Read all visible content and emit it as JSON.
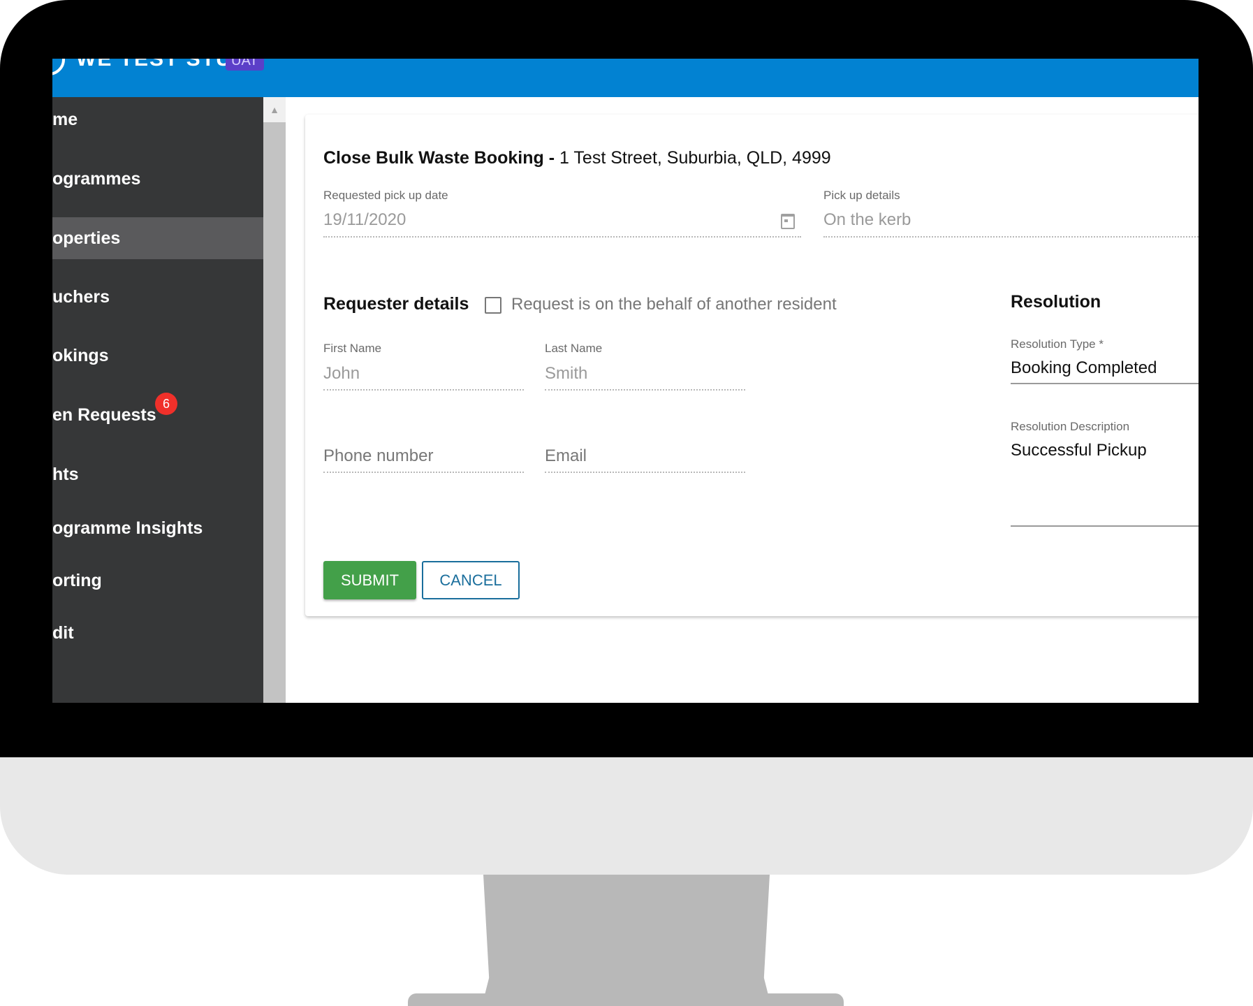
{
  "app": {
    "title": "WE TEST STUFF",
    "env_badge": "UAT"
  },
  "sidebar": {
    "items": [
      {
        "label": "me",
        "active": false
      },
      {
        "label": "ogrammes",
        "active": false
      },
      {
        "label": "operties",
        "active": true
      },
      {
        "label": "uchers",
        "active": false
      },
      {
        "label": "okings",
        "active": false
      },
      {
        "label": "en Requests",
        "active": false,
        "badge": "6"
      },
      {
        "label": "hts",
        "active": false
      },
      {
        "label": "ogramme Insights",
        "active": false
      },
      {
        "label": "orting",
        "active": false
      },
      {
        "label": "dit",
        "active": false
      }
    ]
  },
  "form": {
    "title_bold": "Close Bulk Waste Booking -",
    "title_rest": "1 Test Street, Suburbia, QLD, 4999",
    "pickup_date": {
      "label": "Requested pick up date",
      "value": "19/11/2020"
    },
    "pickup_details": {
      "label": "Pick up details",
      "value": "On the kerb"
    },
    "requester": {
      "title": "Requester details",
      "checkbox_label": "Request is on the behalf of another resident",
      "checkbox_checked": false,
      "first_name": {
        "label": "First Name",
        "value": "John"
      },
      "last_name": {
        "label": "Last Name",
        "value": "Smith"
      },
      "phone": {
        "placeholder": "Phone number"
      },
      "email": {
        "placeholder": "Email"
      }
    },
    "resolution": {
      "title": "Resolution",
      "type": {
        "label": "Resolution Type *",
        "value": "Booking Completed"
      },
      "description": {
        "label": "Resolution Description",
        "value": "Successful Pickup"
      }
    },
    "buttons": {
      "submit": "SUBMIT",
      "cancel": "CANCEL"
    }
  },
  "colors": {
    "topbar": "#0282d2",
    "sidebar": "#363738",
    "submit": "#43a049",
    "cancel": "#1a6e9c",
    "badge": "#f0302a"
  }
}
